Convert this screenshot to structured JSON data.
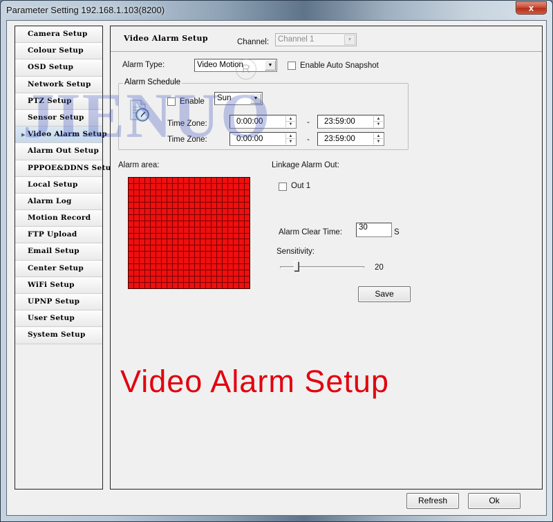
{
  "window": {
    "title": "Parameter Setting 192.168.1.103(8200)",
    "close_label": "x"
  },
  "sidebar": {
    "items": [
      {
        "label": "Camera Setup",
        "active": false
      },
      {
        "label": "Colour Setup",
        "active": false
      },
      {
        "label": "OSD Setup",
        "active": false
      },
      {
        "label": "Network Setup",
        "active": false
      },
      {
        "label": "PTZ Setup",
        "active": false
      },
      {
        "label": "Sensor Setup",
        "active": false
      },
      {
        "label": "Video Alarm Setup",
        "active": true
      },
      {
        "label": "Alarm Out Setup",
        "active": false
      },
      {
        "label": "PPPOE&DDNS Setup",
        "active": false
      },
      {
        "label": "Local Setup",
        "active": false
      },
      {
        "label": "Alarm Log",
        "active": false
      },
      {
        "label": "Motion Record",
        "active": false
      },
      {
        "label": "FTP Upload",
        "active": false
      },
      {
        "label": "Email Setup",
        "active": false
      },
      {
        "label": "Center Setup",
        "active": false
      },
      {
        "label": "WiFi Setup",
        "active": false
      },
      {
        "label": "UPNP Setup",
        "active": false
      },
      {
        "label": "User Setup",
        "active": false
      },
      {
        "label": "System Setup",
        "active": false
      }
    ],
    "active_marker": "▶"
  },
  "main": {
    "title": "Video Alarm Setup",
    "channel_label": "Channel:",
    "channel_value": "Channel 1",
    "alarm_type_label": "Alarm Type:",
    "alarm_type_value": "Video Motion",
    "auto_snapshot_label": "Enable Auto Snapshot",
    "auto_snapshot_checked": false,
    "schedule": {
      "legend": "Alarm Schedule",
      "enable_label": "Enable",
      "enable_checked": false,
      "day_value": "Sun",
      "icon": "schedule-clock-icon",
      "rows": [
        {
          "label": "Time Zone:",
          "start": "0:00:00",
          "separator": "-",
          "end": "23:59:00"
        },
        {
          "label": "Time Zone:",
          "start": "0:00:00",
          "separator": "-",
          "end": "23:59:00"
        }
      ]
    },
    "alarm_area_label": "Alarm area:",
    "alarm_area": {
      "columns": 22,
      "rows": 18,
      "all_selected": true,
      "cell_color": "#ee0f0f"
    },
    "linkage_label": "Linkage Alarm Out:",
    "out1_label": "Out 1",
    "out1_checked": false,
    "clear_time_label": "Alarm Clear Time:",
    "clear_time_value": "30",
    "clear_time_unit": "S",
    "sensitivity_label": "Sensitivity:",
    "sensitivity_value": "20",
    "sensitivity_fraction": 0.2,
    "save_label": "Save",
    "caption": "Video Alarm Setup",
    "caption_color": "#e2000f"
  },
  "footer": {
    "refresh_label": "Refresh",
    "ok_label": "Ok"
  },
  "watermark": {
    "text": "JIENUO",
    "registered": "R"
  }
}
